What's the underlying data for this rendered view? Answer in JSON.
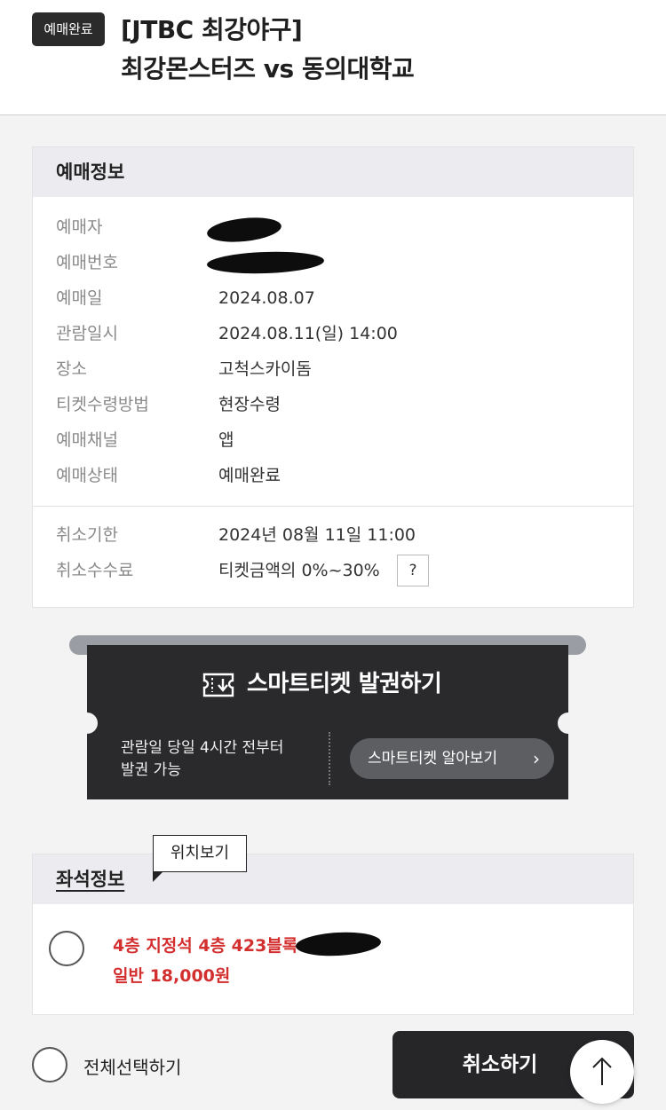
{
  "header": {
    "badge": "예매완료",
    "title_line1": "[JTBC 최강야구]",
    "title_line2": "최강몬스터즈 vs 동의대학교"
  },
  "booking_info": {
    "heading": "예매정보",
    "rows": [
      {
        "label": "예매자",
        "value": ""
      },
      {
        "label": "예매번호",
        "value": ""
      },
      {
        "label": "예매일",
        "value": "2024.08.07"
      },
      {
        "label": "관람일시",
        "value": "2024.08.11(일) 14:00"
      },
      {
        "label": "장소",
        "value": "고척스카이돔"
      },
      {
        "label": "티켓수령방법",
        "value": "현장수령"
      },
      {
        "label": "예매채널",
        "value": "앱"
      },
      {
        "label": "예매상태",
        "value": "예매완료"
      }
    ],
    "cancel_rows": [
      {
        "label": "취소기한",
        "value": "2024년 08월 11일 11:00"
      },
      {
        "label": "취소수수료",
        "value": "티켓금액의 0%~30%"
      }
    ],
    "help_button": "?"
  },
  "smart_ticket": {
    "title": "스마트티켓 발권하기",
    "note_line1": "관람일 당일 4시간 전부터",
    "note_line2": "발권 가능",
    "learn_more": "스마트티켓 알아보기",
    "icon": "ticket-download-icon"
  },
  "seat_info": {
    "heading": "좌석정보",
    "tooltip": "위치보기",
    "seat_line1": "4층 지정석 4층 423블록",
    "seat_line2": "일반 18,000원",
    "accent_color": "#d32f2f"
  },
  "footer": {
    "select_all": "전체선택하기",
    "cancel_button": "취소하기",
    "scroll_top_icon": "arrow-up-icon"
  }
}
